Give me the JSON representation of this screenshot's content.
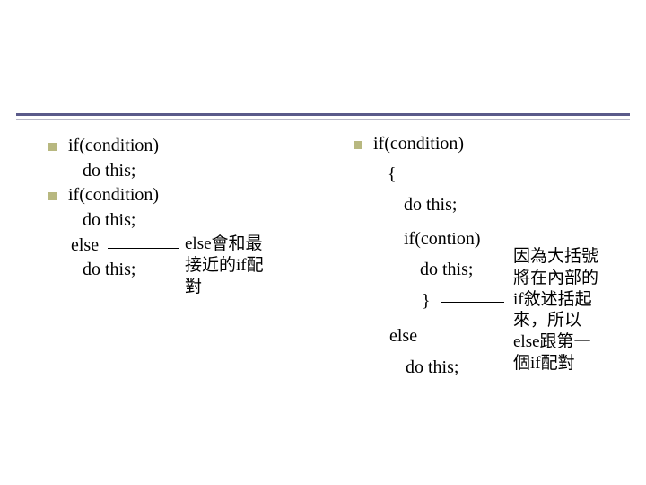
{
  "left": {
    "l1": "if(condition)",
    "l2": "do this;",
    "l3": "if(condition)",
    "l4": "do this;",
    "l5": "else",
    "l6": "do this;",
    "note": "else會和最\n接近的if配\n對"
  },
  "right": {
    "l1": "if(condition)",
    "l2": "{",
    "l3": "do this;",
    "l4": "if(contion)",
    "l5": "do this;",
    "l6": "}",
    "l7": "else",
    "l8": "do this;",
    "note": "因為大括號\n將在內部的\nif敘述括起\n來，所以\nelse跟第一\n個if配對"
  }
}
